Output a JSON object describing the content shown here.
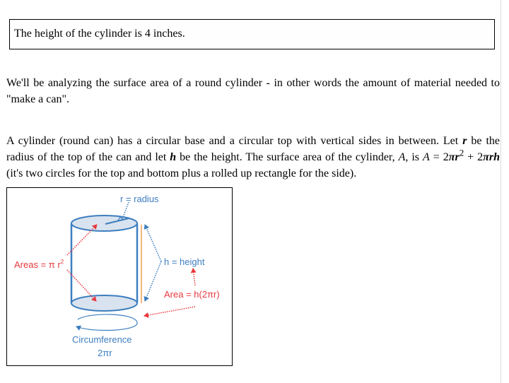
{
  "answer_box": {
    "text": "The height of the cylinder is 4 inches."
  },
  "intro": {
    "text": "We'll be analyzing the surface area of a round cylinder - in other words the amount of material needed to \"make a can\"."
  },
  "explanation": {
    "part1": "A cylinder (round can) has a circular base and a circular top with vertical sides in between. Let ",
    "var_r": "r",
    "part2": " be the radius of the top of the can and let ",
    "var_h": "h",
    "part3": " be the height. The surface area of the cylinder, ",
    "var_A": "A",
    "part4": ", is ",
    "formula_lhs": "A",
    "formula_eq": " = 2",
    "formula_pi1": "πr",
    "formula_exp": "2",
    "formula_plus": " + 2",
    "formula_pirh": "πrh",
    "part5": " (it's two circles for the top and bottom plus a rolled up rectangle for the side)."
  },
  "diagram": {
    "radius_label": "r = radius",
    "areas_label": "Areas = π r",
    "areas_exp": "2",
    "height_label": "h = height",
    "side_area_label": "Area = h(2πr)",
    "circumference_label": "Circumference",
    "circumference_formula": "2πr",
    "colors": {
      "blue": "#3d7ebf",
      "red": "#e8383d",
      "fill": "#d9e3ef",
      "orange": "#f0a050"
    }
  }
}
